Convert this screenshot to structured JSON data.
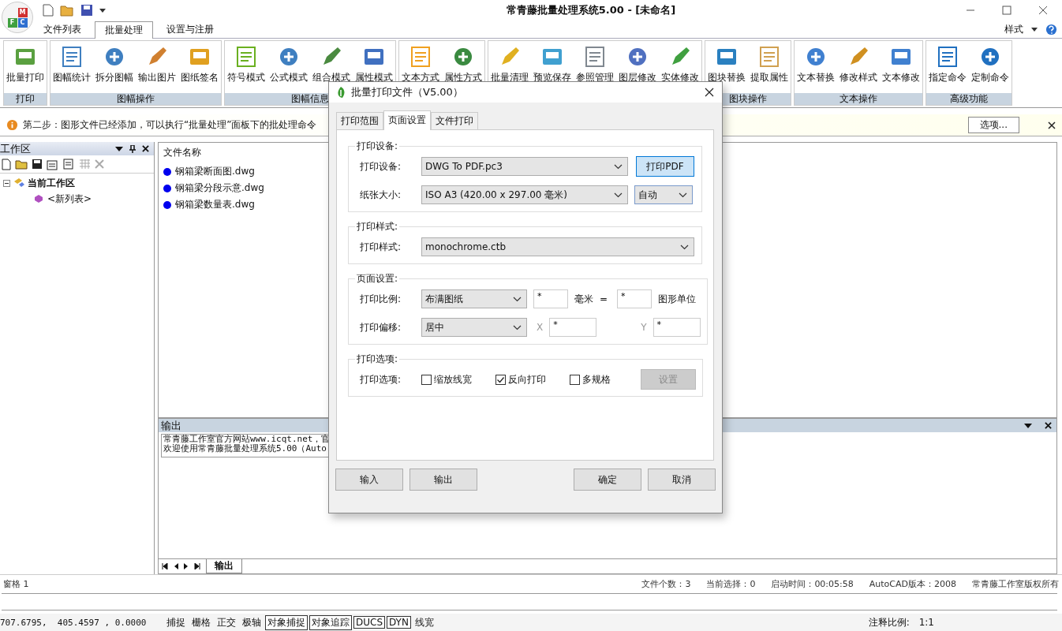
{
  "window": {
    "title": "常青藤批量处理系统5.00 - [未命名]",
    "logo_letters": [
      "M",
      "F",
      "C"
    ]
  },
  "menu_tabs": [
    {
      "label": "文件列表",
      "selected": false
    },
    {
      "label": "批量处理",
      "selected": true
    },
    {
      "label": "设置与注册",
      "selected": false
    }
  ],
  "style_menu": {
    "label": "样式"
  },
  "ribbon": {
    "groups": [
      {
        "label": "打印",
        "buttons": [
          "批量打印"
        ]
      },
      {
        "label": "图幅操作",
        "buttons": [
          "图幅统计",
          "拆分图幅",
          "输出图片",
          "图纸签名"
        ]
      },
      {
        "label": "图幅信息",
        "buttons": [
          "符号模式",
          "公式模式",
          "组合模式",
          "属性模式"
        ]
      },
      {
        "buttons": [
          "文本方式",
          "属性方式"
        ]
      },
      {
        "buttons": [
          "批量清理",
          "预览保存",
          "参照管理",
          "图层修改",
          "实体修改"
        ]
      },
      {
        "label": "图块操作",
        "buttons": [
          "图块替换",
          "提取属性"
        ]
      },
      {
        "label": "文本操作",
        "buttons": [
          "文本替换",
          "修改样式",
          "文本修改"
        ]
      },
      {
        "label": "高级功能",
        "buttons": [
          "指定命令",
          "定制命令"
        ]
      }
    ]
  },
  "info_bar": {
    "message": "第二步：图形文件已经添加，可以执行“批量处理”面板下的批处理命令",
    "button": "选项..."
  },
  "workspace": {
    "title": "工作区",
    "tree": [
      {
        "label": "当前工作区",
        "expanded": true,
        "children": [
          {
            "label": "<新列表>"
          }
        ]
      }
    ]
  },
  "file_list": {
    "header": "文件名称",
    "files": [
      "钢箱梁断面图.dwg",
      "钢箱梁分段示意.dwg",
      "钢箱梁数量表.dwg"
    ]
  },
  "output": {
    "title": "输出",
    "lines": [
      "常青藤工作室官方网站www.icqt.net，官",
      "欢迎使用常青藤批量处理系统5.00（Auto"
    ],
    "tab": "输出"
  },
  "status": {
    "left": "窗格 1",
    "items": [
      "文件个数：3",
      "当前选择：0",
      "启动时间：00:05:58",
      "AutoCAD版本：2008",
      "常青藤工作室版权所有"
    ]
  },
  "command_bar": {
    "coords": "707.6795,  405.4597 , 0.0000",
    "scale_label": "注释比例:",
    "scale": "1:1",
    "toggles": [
      {
        "label": "捕捉",
        "on": false
      },
      {
        "label": "栅格",
        "on": false
      },
      {
        "label": "正交",
        "on": false
      },
      {
        "label": "极轴",
        "on": false
      },
      {
        "label": "对象捕捉",
        "on": true
      },
      {
        "label": "对象追踪",
        "on": true
      },
      {
        "label": "DUCS",
        "on": true
      },
      {
        "label": "DYN",
        "on": true
      },
      {
        "label": "线宽",
        "on": false
      }
    ]
  },
  "dialog": {
    "title": "批量打印文件（V5.00）",
    "tabs": [
      {
        "label": "打印范围",
        "selected": false
      },
      {
        "label": "页面设置",
        "selected": true
      },
      {
        "label": "文件打印",
        "selected": false
      }
    ],
    "device": {
      "legend": "打印设备:",
      "label": "打印设备:",
      "value": "DWG To PDF.pc3",
      "button": "打印PDF",
      "paper_label": "纸张大小:",
      "paper_value": "ISO A3 (420.00 x 297.00 毫米)",
      "paper_mode": "自动"
    },
    "style": {
      "legend": "打印样式:",
      "label": "打印样式:",
      "value": "monochrome.ctb"
    },
    "page": {
      "legend": "页面设置:",
      "scale_label": "打印比例:",
      "scale_value": "布满图纸",
      "mm_value": "*",
      "mm_label": "毫米",
      "equals": "=",
      "unit_value": "*",
      "unit_label": "图形单位",
      "offset_label": "打印偏移:",
      "offset_value": "居中",
      "x_label": "X",
      "x_value": "*",
      "y_label": "Y",
      "y_value": "*"
    },
    "options": {
      "legend": "打印选项:",
      "label": "打印选项:",
      "checks": [
        {
          "label": "缩放线宽",
          "checked": false
        },
        {
          "label": "反向打印",
          "checked": true
        },
        {
          "label": "多规格",
          "checked": false
        }
      ],
      "settings": {
        "label": "设置",
        "disabled": true
      }
    },
    "buttons": [
      "输入",
      "输出",
      "确定",
      "取消"
    ]
  }
}
